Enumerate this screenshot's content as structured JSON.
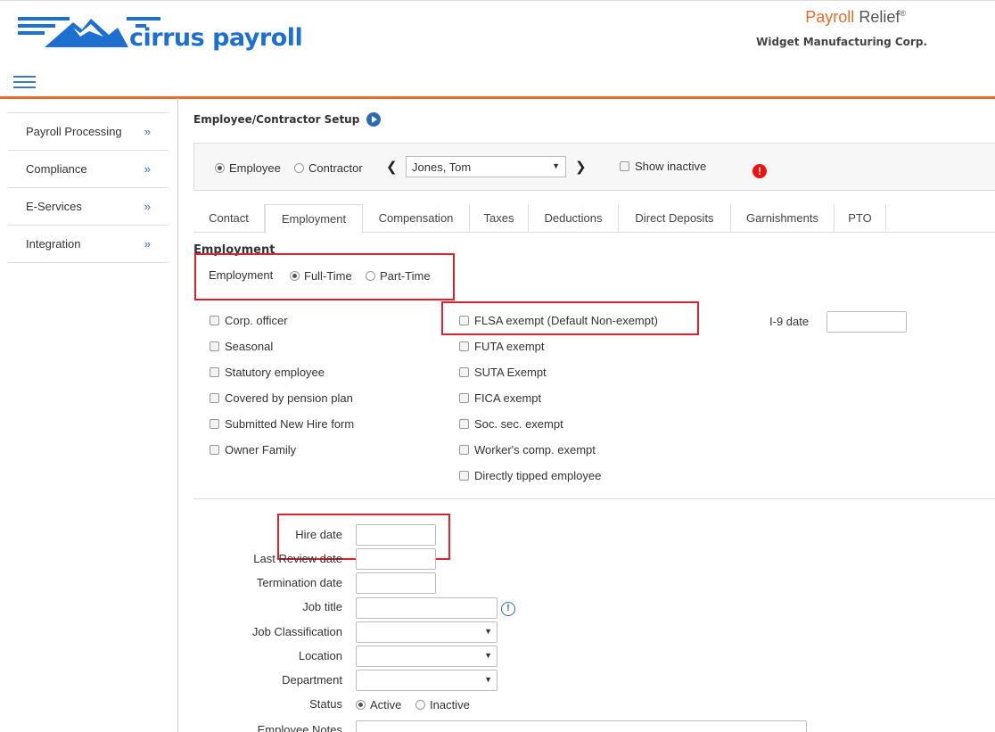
{
  "header": {
    "logo_text": "cirrus payroll",
    "product_part1": "Payroll",
    "product_part2": "Relief",
    "product_mark": "®",
    "company": "Widget Manufacturing Corp."
  },
  "sidebar": {
    "items": [
      {
        "label": "Payroll Processing",
        "arrow": "»"
      },
      {
        "label": "Compliance",
        "arrow": "»"
      },
      {
        "label": "E-Services",
        "arrow": "»"
      },
      {
        "label": "Integration",
        "arrow": "»"
      }
    ]
  },
  "page": {
    "title": "Employee/Contractor Setup",
    "selector": {
      "employee_label": "Employee",
      "contractor_label": "Contractor",
      "selected_type": "Employee",
      "prev_icon": "chevron-left",
      "next_icon": "chevron-right",
      "selected_person": "Jones, Tom",
      "show_inactive_label": "Show inactive",
      "alert_icon": "!"
    },
    "tabs": [
      "Contact",
      "Employment",
      "Compensation",
      "Taxes",
      "Deductions",
      "Direct Deposits",
      "Garnishments",
      "PTO"
    ],
    "active_tab": "Employment",
    "section_title": "Employment",
    "employment_type": {
      "label": "Employment",
      "options": [
        "Full-Time",
        "Part-Time"
      ],
      "selected": "Full-Time"
    },
    "checkboxes_left": [
      "Corp. officer",
      "Seasonal",
      "Statutory employee",
      "Covered by pension plan",
      "Submitted New Hire form",
      "Owner Family"
    ],
    "checkboxes_right": [
      "FLSA exempt (Default Non-exempt)",
      "FUTA exempt",
      "SUTA Exempt",
      "FICA exempt",
      "Soc. sec. exempt",
      "Worker's comp. exempt",
      "Directly tipped employee"
    ],
    "i9_label": "I-9 date",
    "fields": {
      "hire_date": "Hire date",
      "last_review_date": "Last Review date",
      "termination_date": "Termination date",
      "job_title": "Job title",
      "job_classification": "Job Classification",
      "location": "Location",
      "department": "Department",
      "status": "Status",
      "employee_notes": "Employee Notes"
    },
    "status_options": [
      "Active",
      "Inactive"
    ],
    "status_selected": "Active",
    "info_icon": "!"
  },
  "colors": {
    "brand_blue": "#1d6fd0",
    "brand_orange": "#e86b27",
    "highlight_red": "#d9232d"
  }
}
